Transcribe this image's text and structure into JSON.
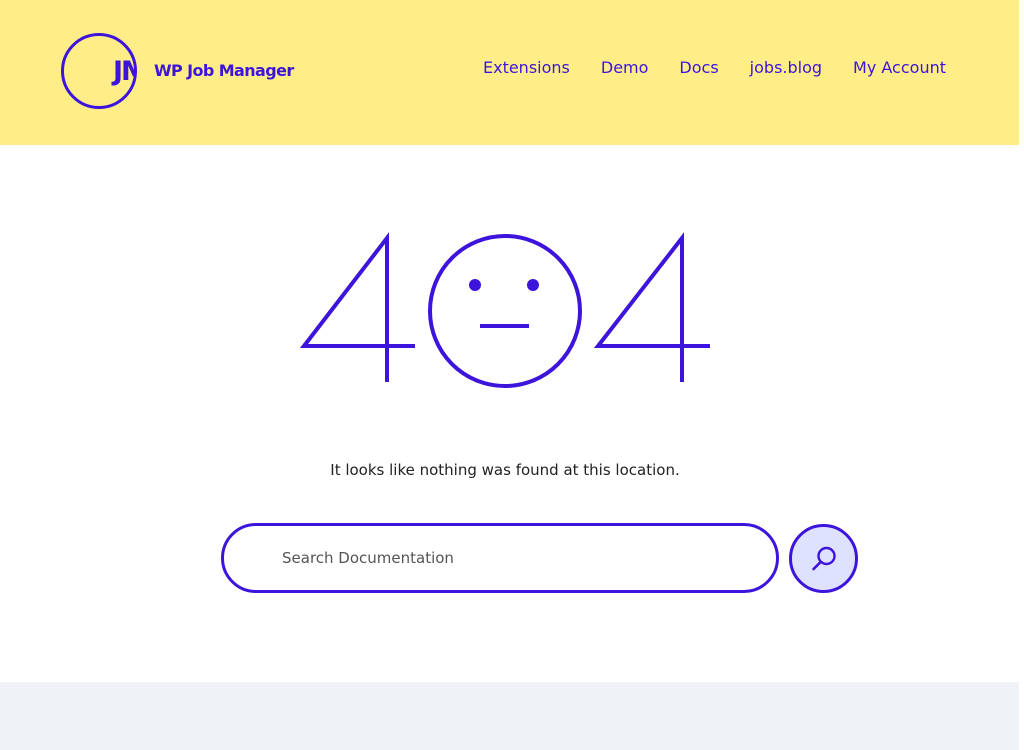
{
  "header": {
    "logo_monogram": "JM",
    "brand_name": "WP Job Manager",
    "nav": [
      {
        "label": "Extensions"
      },
      {
        "label": "Demo"
      },
      {
        "label": "Docs"
      },
      {
        "label": "jobs.blog"
      },
      {
        "label": "My Account"
      }
    ]
  },
  "error": {
    "code": "404",
    "message": "It looks like nothing was found at this location."
  },
  "search": {
    "placeholder": "Search Documentation",
    "value": "",
    "button_icon": "search-icon"
  },
  "colors": {
    "brand": "#3d14dc",
    "header_bg": "#ffee88",
    "search_button_bg": "#dfe2ff",
    "footer_bg": "#eff2f7"
  }
}
